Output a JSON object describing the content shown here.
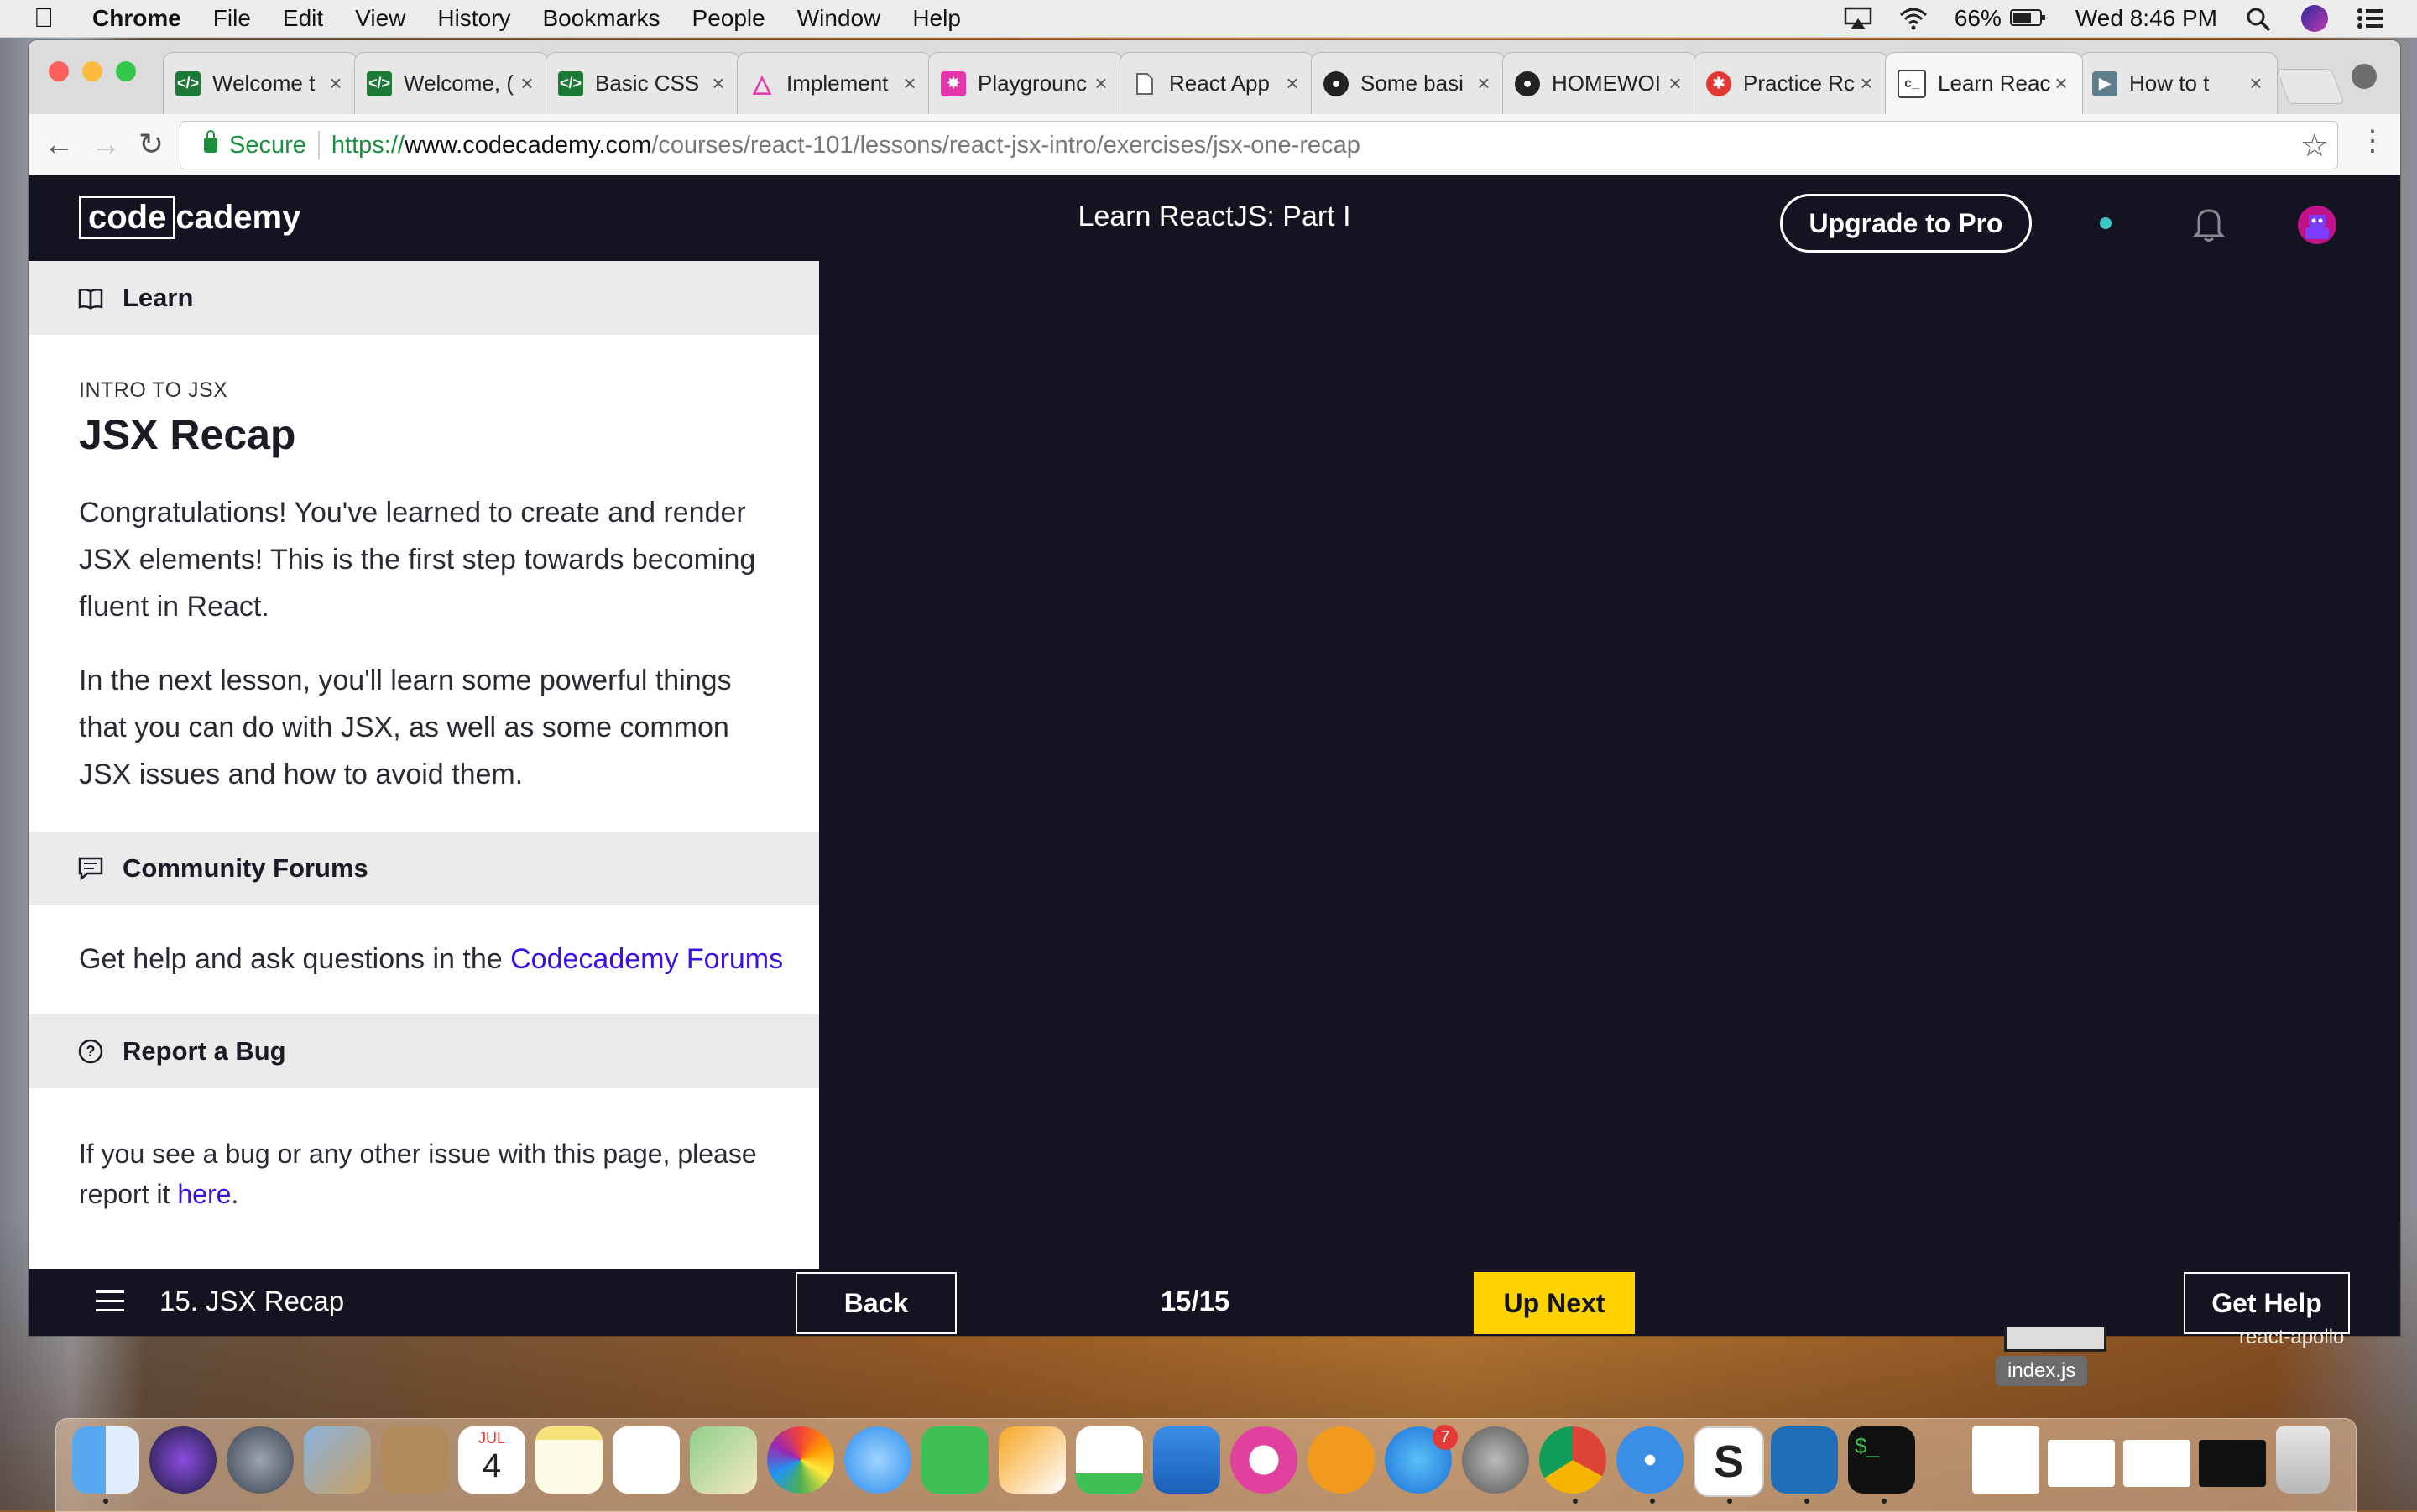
{
  "menubar": {
    "app": "Chrome",
    "items": [
      "File",
      "Edit",
      "View",
      "History",
      "Bookmarks",
      "People",
      "Window",
      "Help"
    ],
    "battery": "66%",
    "clock": "Wed 8:46 PM"
  },
  "tabs": [
    {
      "title": "Welcome t",
      "favicon_color": "#1d7a36",
      "active": false
    },
    {
      "title": "Welcome, (",
      "favicon_color": "#1d7a36",
      "active": false
    },
    {
      "title": "Basic CSS",
      "favicon_color": "#1d7a36",
      "active": false
    },
    {
      "title": "Implement",
      "favicon_color": "#e535ab",
      "active": false
    },
    {
      "title": "Playgrounc",
      "favicon_color": "#e535ab",
      "active": false
    },
    {
      "title": "React App",
      "favicon_color": "#9e9e9e",
      "active": false
    },
    {
      "title": "Some basi",
      "favicon_color": "#222222",
      "active": false
    },
    {
      "title": "HOMEWOI",
      "favicon_color": "#222222",
      "active": false
    },
    {
      "title": "Practice Rc",
      "favicon_color": "#e53935",
      "active": false
    },
    {
      "title": "Learn Reac",
      "favicon_color": "#444444",
      "active": true
    },
    {
      "title": "How to t",
      "favicon_color": "#607d8b",
      "active": false
    }
  ],
  "tab_close_glyph": "×",
  "address": {
    "security_label": "Secure",
    "scheme": "https://",
    "host": "www.codecademy.com",
    "path": "/courses/react-101/lessons/react-jsx-intro/exercises/jsx-one-recap"
  },
  "header": {
    "logo_boxed": "code",
    "logo_rest": "cademy",
    "course_title": "Learn ReactJS: Part I",
    "upgrade_label": "Upgrade to Pro",
    "accent": "#3bc7c4"
  },
  "lesson": {
    "learn_label": "Learn",
    "kicker": "INTRO TO JSX",
    "title": "JSX Recap",
    "paragraph_1": "Congratulations! You've learned to create and render JSX elements! This is the first step towards becoming fluent in React.",
    "paragraph_2": "In the next lesson, you'll learn some powerful things that you can do with JSX, as well as some common JSX issues and how to avoid them.",
    "forums_label": "Community Forums",
    "forums_text": "Get help and ask questions in the ",
    "forums_link": "Codecademy Forums",
    "bug_label": "Report a Bug",
    "bug_text": "If you see a bug or any other issue with this page, please report it ",
    "bug_link": "here",
    "bug_end": "."
  },
  "footer": {
    "lesson_label": "15. JSX Recap",
    "back_label": "Back",
    "progress": "15/15",
    "next_label": "Up Next",
    "help_label": "Get Help",
    "next_color": "#ffd300"
  },
  "desktop": {
    "file_1": "index.js",
    "file_2": "react-apollo"
  },
  "dock": {
    "badge": "7",
    "apps": [
      "Finder",
      "Siri",
      "Launchpad",
      "Mail Stamp",
      "Contacts",
      "Calendar",
      "Notes",
      "Reminders",
      "Maps",
      "Photos",
      "Messages",
      "FaceTime",
      "Pages",
      "Numbers",
      "Keynote",
      "iTunes",
      "iBooks",
      "App Store",
      "System Preferences",
      "Chrome",
      "Safari",
      "Slack",
      "VS Code",
      "Terminal",
      "File C",
      "Screenshot 1",
      "Screenshot 2",
      "Screenshot 3",
      "Trash"
    ],
    "calendar_month": "JUL",
    "calendar_day": "4"
  }
}
